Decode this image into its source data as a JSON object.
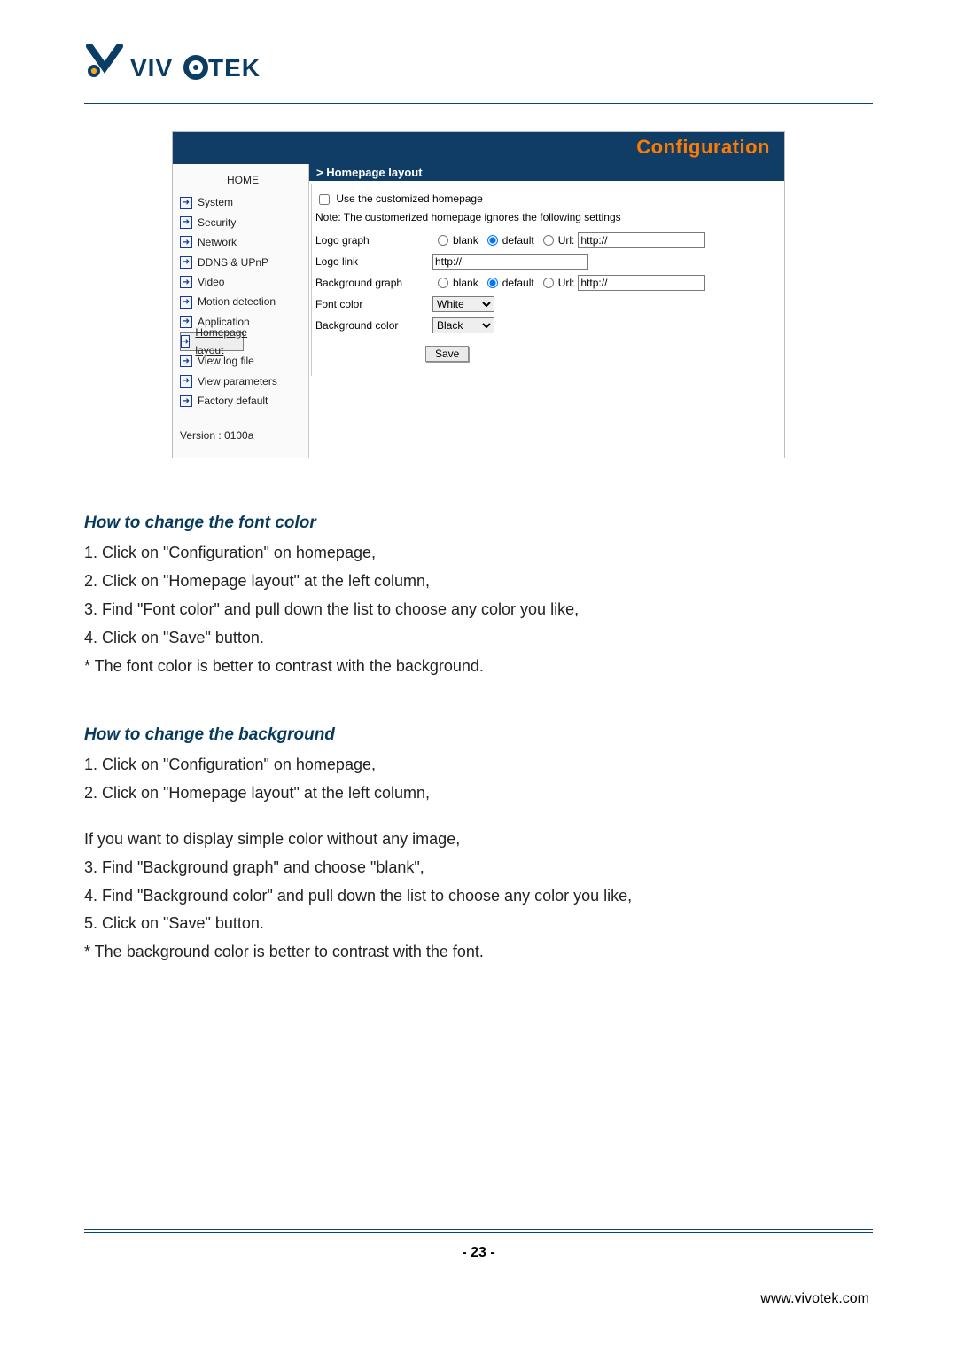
{
  "brand": {
    "name": "VIVOTEK"
  },
  "config": {
    "title": "Configuration",
    "section_header": "> Homepage layout",
    "use_custom_label": "Use the customized homepage",
    "note": "Note: The customerized homepage ignores the following settings",
    "rows": {
      "logo_graph_label": "Logo graph",
      "logo_link_label": "Logo link",
      "bg_graph_label": "Background graph",
      "font_color_label": "Font color",
      "bg_color_label": "Background color"
    },
    "radio": {
      "blank": "blank",
      "default": "default",
      "url": "Url:"
    },
    "logo_url_value": "http://",
    "logo_link_value": "http://",
    "bg_url_value": "http://",
    "font_color_value": "White",
    "bg_color_value": "Black",
    "save_label": "Save"
  },
  "nav": {
    "home": "HOME",
    "items": [
      "System",
      "Security",
      "Network",
      "DDNS & UPnP",
      "Video",
      "Motion detection",
      "Application",
      "Homepage layout",
      "View log file",
      "View parameters",
      "Factory default"
    ],
    "selected_index": 7,
    "version": "Version : 0100a"
  },
  "manual": {
    "section1": {
      "title": "How to change the font color",
      "lines": [
        "1. Click on \"Configuration\" on homepage,",
        "2. Click on \"Homepage layout\" at the left column,",
        "3. Find \"Font color\" and pull down the list to choose any color you like,",
        "4. Click on \"Save\" button.",
        "* The font color is better to contrast with the background."
      ]
    },
    "section2": {
      "title": "How to change the background",
      "lines_a": [
        "1. Click on \"Configuration\" on homepage,",
        "2. Click on \"Homepage layout\" at the left column,"
      ],
      "mid": "If you want to display simple color without any image,",
      "lines_b": [
        "3. Find \"Background graph\" and choose \"blank\",",
        "4. Find \"Background color\" and pull down the list to choose any color you like,",
        "5. Click on \"Save\" button.",
        "* The background color is better to contrast with the font."
      ]
    }
  },
  "footer": {
    "page_number": "- 23 -",
    "site": "www.vivotek.com"
  }
}
